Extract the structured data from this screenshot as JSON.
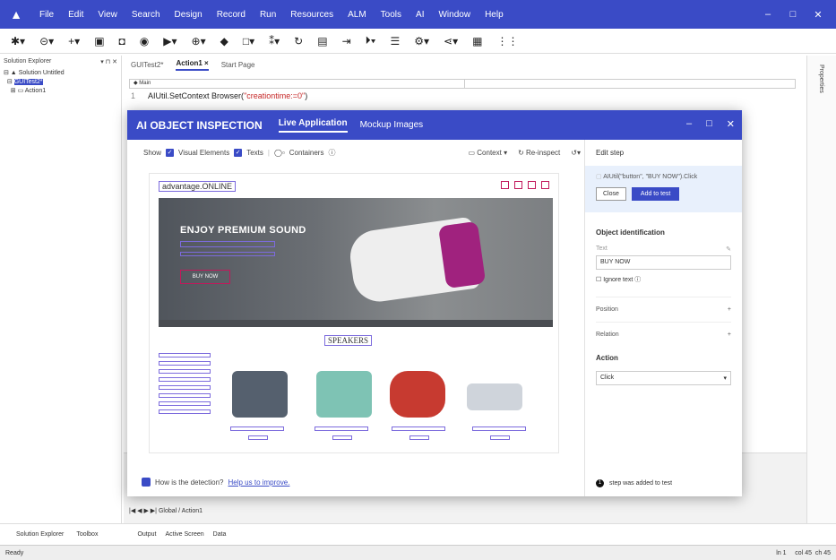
{
  "menubar": {
    "items": [
      "File",
      "Edit",
      "View",
      "Search",
      "Design",
      "Record",
      "Run",
      "Resources",
      "ALM",
      "Tools",
      "AI",
      "Window",
      "Help"
    ]
  },
  "toolbar": {
    "icons": [
      "asterisk-icon",
      "open-icon",
      "add-icon",
      "save-icon",
      "record-icon",
      "run-icon",
      "debug-icon",
      "object-spy-icon",
      "window-icon",
      "checkpoint-icon",
      "sync-icon",
      "db-icon",
      "step-icon",
      "breakpoint-icon",
      "list-icon",
      "settings-icon",
      "share-icon",
      "report-icon",
      "grid-icon"
    ]
  },
  "solution_explorer": {
    "title": "Solution Explorer",
    "pin": "▾ ⊓ ✕",
    "tree": [
      "Solution Untitled",
      "GUITest2*",
      "Action1"
    ]
  },
  "doc_tabs": {
    "tab1": "GUITest2*",
    "tab2": "Action1 ×",
    "tab3": "Start Page"
  },
  "editor": {
    "scope": "Main",
    "line_no": "1",
    "code_prefix": "AIUtil.SetContext Browser(",
    "code_string": "\"creationtime:=0\"",
    "code_suffix": ")"
  },
  "right_strip": {
    "label": "Properties"
  },
  "bottom_tabs": {
    "solution_explorer": "Solution Explorer",
    "toolbox": "Toolbox",
    "output": "Output",
    "active_screen": "Active Screen",
    "data": "Data",
    "sheet_global": "Global",
    "sheet_action": "Action1"
  },
  "status": {
    "left": "Ready",
    "ln": "ln 1",
    "col": "col 45",
    "ch": "ch 45"
  },
  "ai_window": {
    "title": "AI OBJECT INSPECTION",
    "tab_live": "Live Application",
    "tab_mockup": "Mockup Images",
    "show": "Show",
    "visual_elements": "Visual Elements",
    "texts": "Texts",
    "containers": "Containers",
    "context": "Context",
    "reinspect": "Re-inspect",
    "feedback_q": "How is the detection?",
    "feedback_link": "Help us to improve."
  },
  "preview": {
    "logo": "advantage.ONLINE",
    "hero_title": "ENJOY PREMIUM SOUND",
    "buy_now": "BUY NOW",
    "section": "SPEAKERS"
  },
  "edit_panel": {
    "title": "Edit step",
    "step": "AIUtil(\"button\", \"BUY NOW\").Click",
    "close": "Close",
    "add": "Add to test",
    "obj_id": "Object identification",
    "text_label": "Text",
    "text_value": "BUY NOW",
    "ignore": "Ignore text",
    "position": "Position",
    "relation": "Relation",
    "action": "Action",
    "action_value": "Click",
    "toast": "step was added to test",
    "toast_count": "1"
  }
}
